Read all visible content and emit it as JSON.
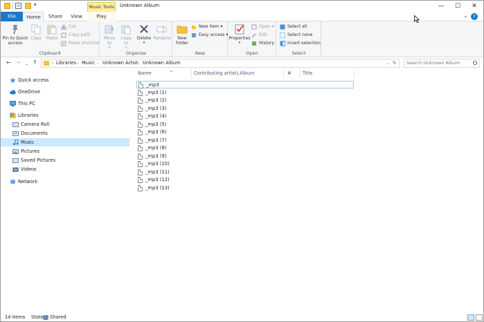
{
  "window": {
    "title": "Unknown Album",
    "context_tab": "Music Tools",
    "minimize": "—",
    "maximize": "☐",
    "close": "✕"
  },
  "tabs": {
    "file": "File",
    "home": "Home",
    "share": "Share",
    "view": "View",
    "play": "Play",
    "help": "?"
  },
  "ribbon": {
    "clipboard": {
      "label": "Clipboard",
      "pin": "Pin to Quick access",
      "copy": "Copy",
      "paste": "Paste",
      "cut": "Cut",
      "copy_path": "Copy path",
      "paste_shortcut": "Paste shortcut"
    },
    "organise": {
      "label": "Organise",
      "move_to": "Move to",
      "copy_to": "Copy to",
      "delete": "Delete",
      "rename": "Rename"
    },
    "new": {
      "label": "New",
      "new_folder": "New folder",
      "new_item": "New item",
      "easy_access": "Easy access"
    },
    "open": {
      "label": "Open",
      "properties": "Properties",
      "open": "Open",
      "edit": "Edit",
      "history": "History"
    },
    "select": {
      "label": "Select",
      "select_all": "Select all",
      "select_none": "Select none",
      "invert": "Invert selection"
    }
  },
  "address": {
    "crumbs": [
      "Libraries",
      "Music",
      "Unknown Artist",
      "Unknown Album"
    ],
    "search_placeholder": "Search Unknown Album"
  },
  "nav": {
    "items": [
      {
        "label": "Quick access"
      },
      {
        "label": "OneDrive"
      },
      {
        "label": "This PC"
      },
      {
        "label": "Libraries"
      },
      {
        "label": "Camera Roll"
      },
      {
        "label": "Documents"
      },
      {
        "label": "Music"
      },
      {
        "label": "Pictures"
      },
      {
        "label": "Saved Pictures"
      },
      {
        "label": "Videos"
      },
      {
        "label": "Network"
      }
    ]
  },
  "columns": [
    "Name",
    "Contributing artists",
    "Album",
    "#",
    "Title"
  ],
  "files": [
    "_mp3",
    "_mp3 (1)",
    "_mp3 (2)",
    "_mp3 (3)",
    "_mp3 (4)",
    "_mp3 (5)",
    "_mp3 (6)",
    "_mp3 (7)",
    "_mp3 (8)",
    "_mp3 (9)",
    "_mp3 (10)",
    "_mp3 (11)",
    "_mp3 (12)",
    "_mp3 (13)"
  ],
  "status": {
    "items": "14 items",
    "state_label": "State:",
    "state_value": "Shared"
  }
}
